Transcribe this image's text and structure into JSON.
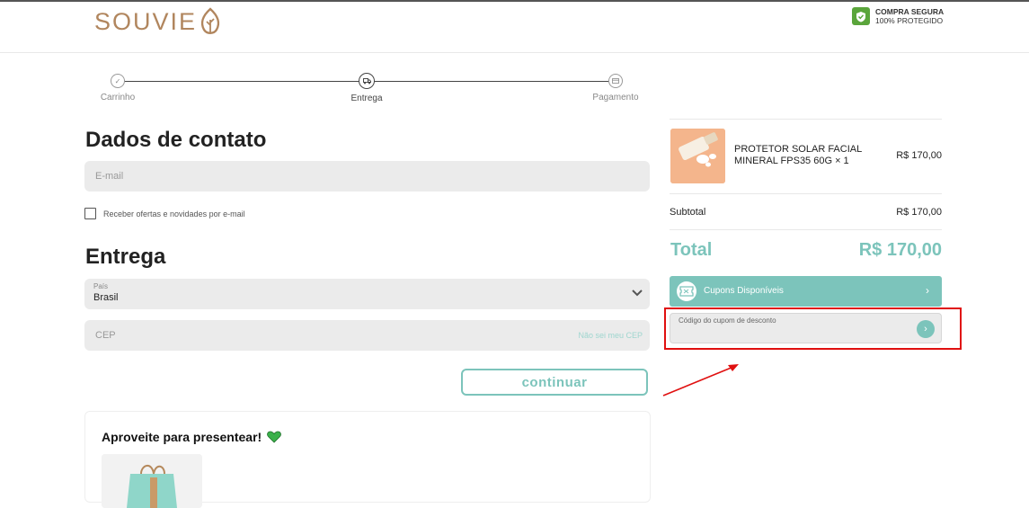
{
  "header": {
    "brand": "SOUVIE",
    "secure_line1": "COMPRA SEGURA",
    "secure_line2": "100% PROTEGIDO"
  },
  "stepper": {
    "steps": [
      {
        "label": "Carrinho",
        "state": "done"
      },
      {
        "label": "Entrega",
        "state": "active"
      },
      {
        "label": "Pagamento",
        "state": "pending"
      }
    ]
  },
  "contact": {
    "title": "Dados de contato",
    "email_placeholder": "E-mail",
    "newsletter_label": "Receber ofertas e novidades por e-mail"
  },
  "delivery": {
    "title": "Entrega",
    "country_label": "País",
    "country_value": "Brasil",
    "cep_placeholder": "CEP",
    "cep_help_link": "Não sei meu CEP",
    "continue_label": "continuar"
  },
  "gift": {
    "title": "Aproveite para presentear!"
  },
  "summary": {
    "item_name": "PROTETOR SOLAR FACIAL MINERAL FPS35 60G × 1",
    "item_price": "R$ 170,00",
    "subtotal_label": "Subtotal",
    "subtotal_value": "R$ 170,00",
    "total_label": "Total",
    "total_value": "R$ 170,00",
    "coupons_label": "Cupons Disponíveis",
    "coupon_field_label": "Código do cupom de desconto"
  },
  "colors": {
    "accent": "#7cc4bb",
    "brand": "#b1865e",
    "highlight": "#e01010",
    "secure_badge": "#5aa53b"
  },
  "icons": [
    "leaf-logo-icon",
    "shield-check-icon",
    "check-icon",
    "truck-icon",
    "card-icon",
    "chevron-down-icon",
    "heart-icon",
    "coupon-icon",
    "chevron-right-icon",
    "arrow-right-icon"
  ]
}
